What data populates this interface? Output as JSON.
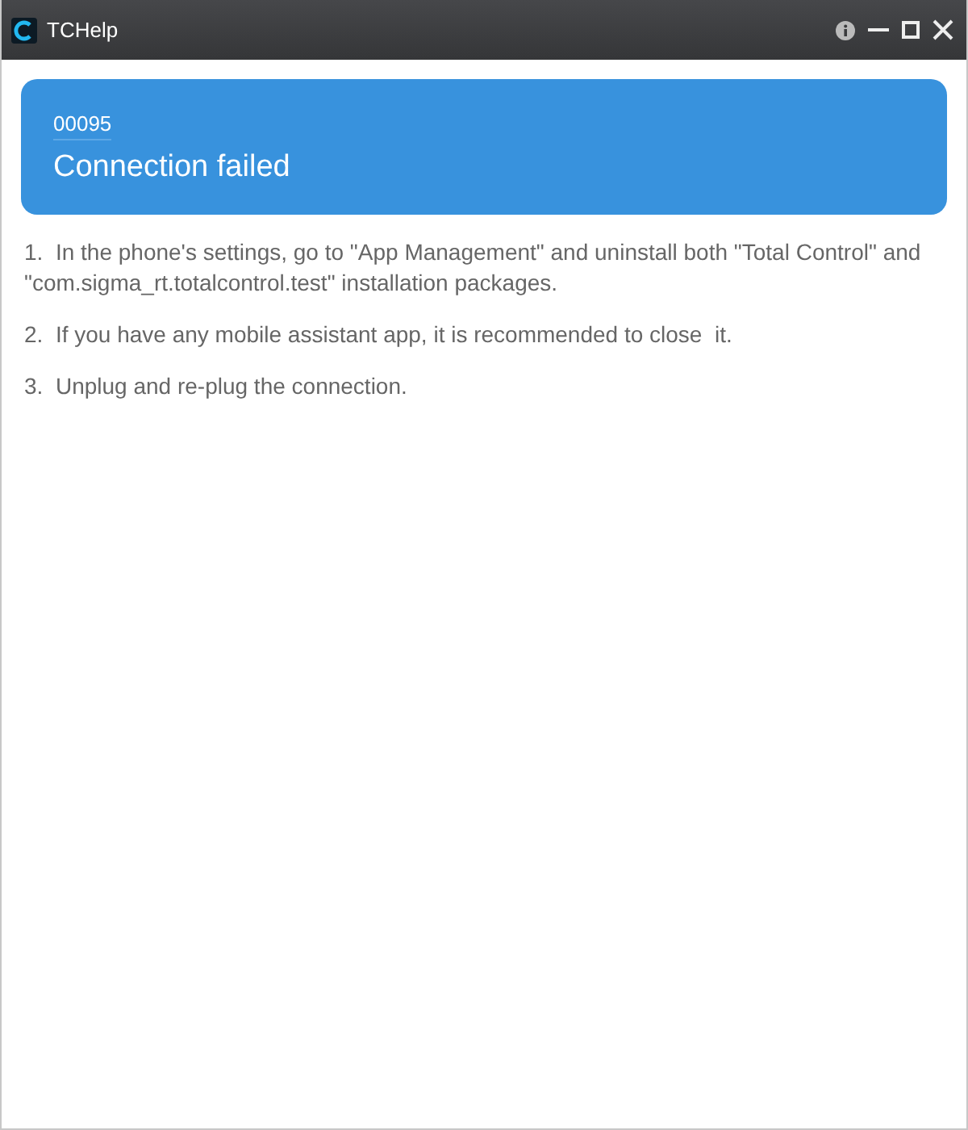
{
  "window": {
    "title": "TCHelp"
  },
  "error": {
    "code": "00095",
    "title": "Connection failed"
  },
  "steps": [
    "1.  In the phone's settings, go to \"App Management\" and uninstall both \"Total Control\" and \"com.sigma_rt.totalcontrol.test\" installation packages.",
    "2.  If you have any mobile assistant app, it is recommended to close  it.",
    "3.  Unplug and re-plug the connection."
  ]
}
